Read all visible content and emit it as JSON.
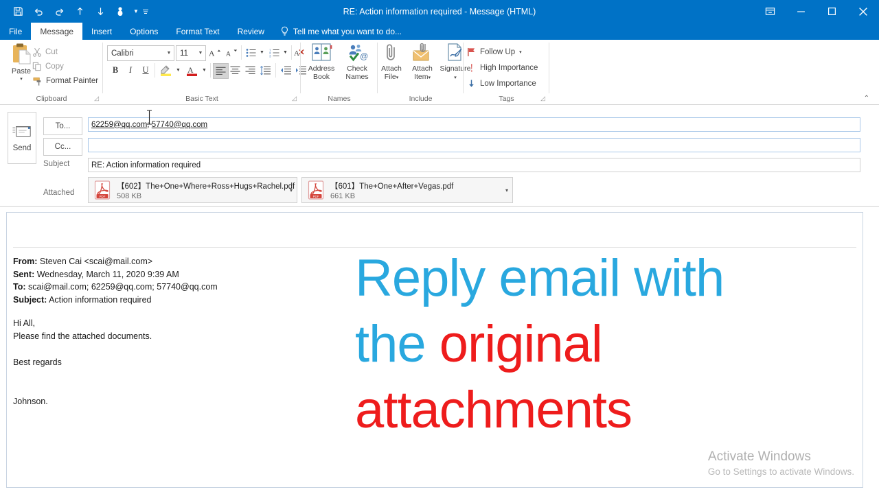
{
  "window": {
    "title": "RE: Action information required - Message (HTML)",
    "accent_color": "#0072c6",
    "quick_access": [
      {
        "name": "save-icon",
        "label": "Save"
      },
      {
        "name": "undo-icon",
        "label": "Undo"
      },
      {
        "name": "redo-icon",
        "label": "Redo"
      },
      {
        "name": "previous-item-icon",
        "label": "Previous Item"
      },
      {
        "name": "next-item-icon",
        "label": "Next Item"
      },
      {
        "name": "touch-mode-icon",
        "label": "Touch/Mouse Mode"
      },
      {
        "name": "customize-qat-icon",
        "label": "Customize Quick Access Toolbar"
      }
    ],
    "controls": {
      "ribbon_display": "Ribbon Display Options",
      "minimize": "Minimize",
      "maximize": "Restore Down",
      "close": "Close"
    }
  },
  "tabs": [
    {
      "label": "File",
      "active": false
    },
    {
      "label": "Message",
      "active": true
    },
    {
      "label": "Insert",
      "active": false
    },
    {
      "label": "Options",
      "active": false
    },
    {
      "label": "Format Text",
      "active": false
    },
    {
      "label": "Review",
      "active": false
    }
  ],
  "tell_me": {
    "placeholder": "Tell me what you want to do..."
  },
  "ribbon": {
    "collapse_label": "⌃",
    "groups": [
      {
        "name": "clipboard",
        "label": "Clipboard",
        "dialog_launcher": true
      },
      {
        "name": "basic-text",
        "label": "Basic Text",
        "dialog_launcher": true
      },
      {
        "name": "names",
        "label": "Names",
        "dialog_launcher": false
      },
      {
        "name": "include",
        "label": "Include",
        "dialog_launcher": false
      },
      {
        "name": "tags",
        "label": "Tags",
        "dialog_launcher": true
      }
    ],
    "clipboard": {
      "paste": "Paste",
      "paste_caret": "▾",
      "cut": "Cut",
      "copy": "Copy",
      "format_painter": "Format Painter"
    },
    "basic_text": {
      "font_name": "Calibri",
      "font_size": "11",
      "grow_font": "A",
      "shrink_font": "A",
      "bold": "B",
      "italic": "I",
      "underline": "U",
      "text_highlight": "ab",
      "font_color": "A",
      "bullets": "bullet-list-icon",
      "numbering": "numbered-list-icon",
      "clear_formatting": "clear-formatting-icon",
      "align_left": "align-left-icon",
      "align_center": "align-center-icon",
      "align_right": "align-right-icon",
      "line_spacing": "line-spacing-icon",
      "decrease_indent": "decrease-indent-icon",
      "increase_indent": "increase-indent-icon"
    },
    "names": {
      "address_book": "Address\nBook",
      "address_book_line1": "Address",
      "address_book_line2": "Book",
      "check_names_line1": "Check",
      "check_names_line2": "Names"
    },
    "include": {
      "attach_file_line1": "Attach",
      "attach_file_line2": "File",
      "attach_item_line1": "Attach",
      "attach_item_line2": "Item",
      "signature_line1": "Signature",
      "caret": "▾"
    },
    "tags": {
      "follow_up": "Follow Up",
      "follow_up_caret": "▾",
      "high_importance": "High Importance",
      "low_importance": "Low Importance"
    }
  },
  "compose": {
    "send_button": "Send",
    "to_button": "To...",
    "cc_button": "Cc...",
    "subject_label": "Subject",
    "attached_label": "Attached",
    "to_value": "62259@qq.com; 57740@qq.com",
    "to_recipients": [
      "62259@qq.com",
      "57740@qq.com"
    ],
    "cc_value": "",
    "subject_value": "RE: Action information required",
    "attachments": [
      {
        "name": "【602】The+One+Where+Ross+Hugs+Rachel.pdf",
        "size": "508 KB",
        "type": "pdf",
        "caret": "▾"
      },
      {
        "name": "【601】The+One+After+Vegas.pdf",
        "size": "661 KB",
        "type": "pdf",
        "caret": "▾"
      }
    ]
  },
  "message_body": {
    "quoted_header": [
      {
        "label": "From:",
        "value": " Steven Cai <scai@mail.com>"
      },
      {
        "label": "Sent:",
        "value": " Wednesday, March 11, 2020 9:39 AM"
      },
      {
        "label": "To:",
        "value": " scai@mail.com; 62259@qq.com; 57740@qq.com"
      },
      {
        "label": "Subject:",
        "value": " Action information required"
      }
    ],
    "lines": [
      "Hi All,",
      "Please find the attached documents.",
      "",
      "Best regards",
      "",
      "",
      "Johnson."
    ]
  },
  "overlay": {
    "blue_color": "#29a8df",
    "red_color": "#ee1c1c",
    "line1_blue": "Reply email with",
    "line2_blue": "the ",
    "line2_red": "original",
    "line3_red": "attachments"
  },
  "watermark": {
    "title": "Activate Windows",
    "subtitle": "Go to Settings to activate Windows."
  }
}
